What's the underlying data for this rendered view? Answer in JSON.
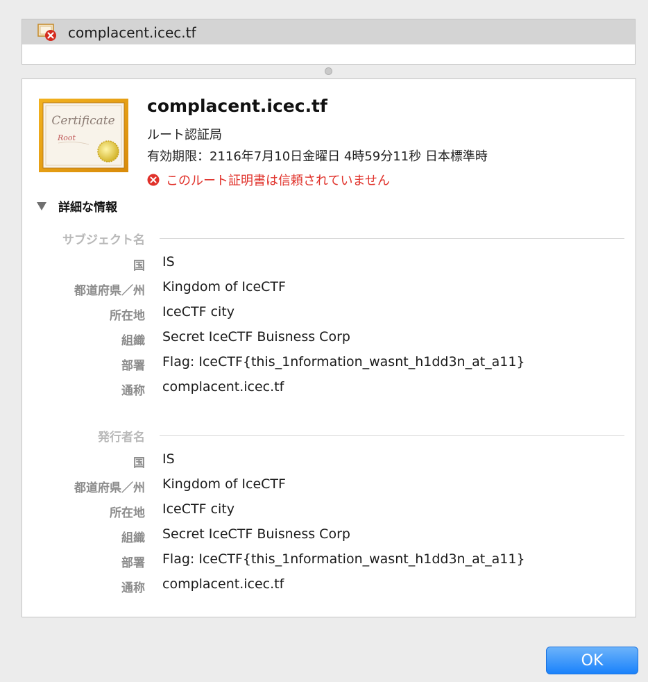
{
  "chain": {
    "items": [
      {
        "label": "complacent.icec.tf",
        "icon": "certificate-error-icon"
      }
    ]
  },
  "certificate": {
    "image_text_1": "Certificate",
    "image_text_2": "Root",
    "title": "complacent.icec.tf",
    "kind": "ルート認証局",
    "expiry": "有効期限：2116年7月10日金曜日 4時59分11秒 日本標準時",
    "warning": "このルート証明書は信頼されていません",
    "warning_color": "#e0312a"
  },
  "details": {
    "toggle_label": "詳細な情報",
    "subject": {
      "header": "サブジェクト名",
      "fields": [
        {
          "label": "国",
          "value": "IS"
        },
        {
          "label": "都道府県／州",
          "value": "Kingdom of IceCTF"
        },
        {
          "label": "所在地",
          "value": "IceCTF city"
        },
        {
          "label": "組織",
          "value": "Secret IceCTF Buisness Corp"
        },
        {
          "label": "部署",
          "value": "Flag: IceCTF{this_1nformation_wasnt_h1dd3n_at_a11}"
        },
        {
          "label": "通称",
          "value": "complacent.icec.tf"
        }
      ]
    },
    "issuer": {
      "header": "発行者名",
      "fields": [
        {
          "label": "国",
          "value": "IS"
        },
        {
          "label": "都道府県／州",
          "value": "Kingdom of IceCTF"
        },
        {
          "label": "所在地",
          "value": "IceCTF city"
        },
        {
          "label": "組織",
          "value": "Secret IceCTF Buisness Corp"
        },
        {
          "label": "部署",
          "value": "Flag: IceCTF{this_1nformation_wasnt_h1dd3n_at_a11}"
        },
        {
          "label": "通称",
          "value": "complacent.icec.tf"
        }
      ]
    }
  },
  "footer": {
    "ok_label": "OK",
    "accent": "#1a82fb"
  }
}
